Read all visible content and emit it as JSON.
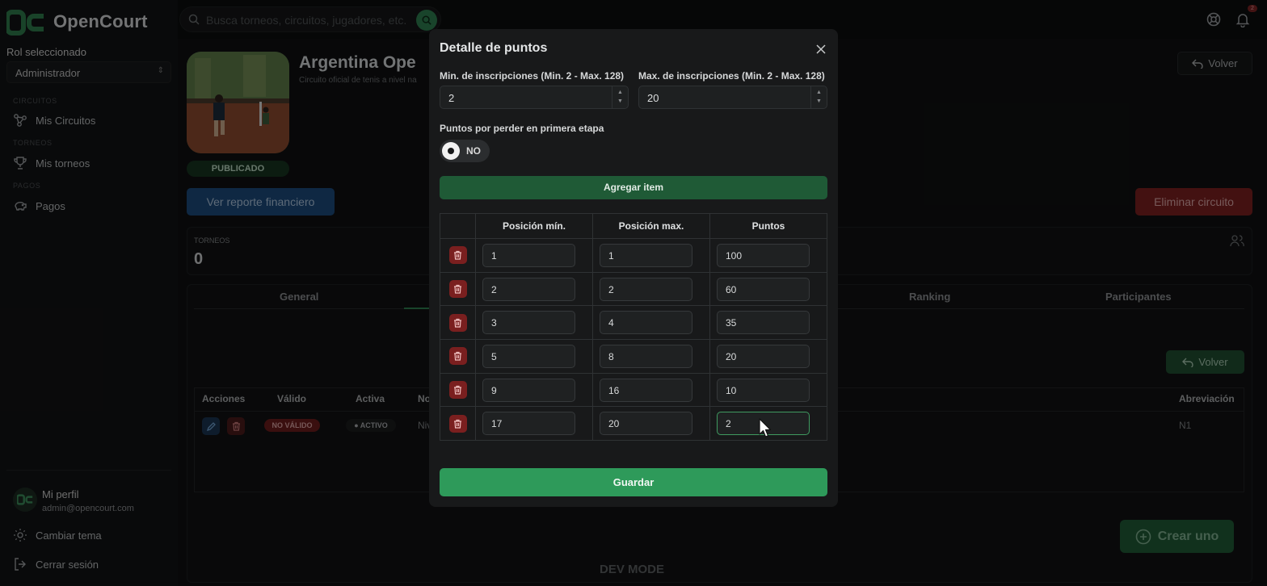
{
  "app": {
    "name": "OpenCourt"
  },
  "sidebar": {
    "role_label": "Rol seleccionado",
    "role_value": "Administrador",
    "sections": [
      {
        "title": "CIRCUITOS",
        "item": "Mis Circuitos",
        "icon": "network-icon"
      },
      {
        "title": "TORNEOS",
        "item": "Mis torneos",
        "icon": "trophy-icon"
      },
      {
        "title": "PAGOS",
        "item": "Pagos",
        "icon": "piggy-bank-icon"
      }
    ],
    "profile": {
      "name": "Mi perfil",
      "email": "admin@opencourt.com"
    },
    "theme_label": "Cambiar tema",
    "logout_label": "Cerrar sesión"
  },
  "topbar": {
    "search_placeholder": "Busca torneos, circuitos, jugadores, etc.",
    "notification_count": "2"
  },
  "circuit": {
    "title": "Argentina Ope",
    "subtitle": "Circuito oficial de tenis a nivel na",
    "status": "PUBLICADO",
    "back_label": "Volver",
    "report_label": "Ver reporte financiero",
    "delete_label": "Eliminar circuito",
    "stat_label": "TORNEOS",
    "stat_value": "0"
  },
  "tabs": [
    "General",
    "Ranking",
    "Participantes"
  ],
  "levels_table": {
    "back_label": "Volver",
    "headers": [
      "Acciones",
      "Válido",
      "Activa",
      "No",
      "Abreviación"
    ],
    "row": {
      "valid": "NO VÁLIDO",
      "active": "ACTIVO",
      "name": "Niv",
      "abbr": "N1"
    }
  },
  "create_label": "Crear uno",
  "dev_mode": "DEV MODE",
  "modal": {
    "title": "Detalle de puntos",
    "min_label": "Min. de inscripciones (Min. 2 - Max. 128)",
    "min_value": "2",
    "max_label": "Max. de inscripciones (Min. 2 - Max. 128)",
    "max_value": "20",
    "toggle_label": "Puntos por perder en primera etapa",
    "toggle_value": "NO",
    "add_label": "Agregar item",
    "columns": [
      "Posición mín.",
      "Posición max.",
      "Puntos"
    ],
    "rows": [
      {
        "min": "1",
        "max": "1",
        "points": "100"
      },
      {
        "min": "2",
        "max": "2",
        "points": "60"
      },
      {
        "min": "3",
        "max": "4",
        "points": "35"
      },
      {
        "min": "5",
        "max": "8",
        "points": "20"
      },
      {
        "min": "9",
        "max": "16",
        "points": "10"
      },
      {
        "min": "17",
        "max": "20",
        "points": "2"
      }
    ],
    "save_label": "Guardar"
  },
  "colors": {
    "accent": "#2e9a5a",
    "danger": "#7a1f1f",
    "info": "#1c4a7a"
  }
}
